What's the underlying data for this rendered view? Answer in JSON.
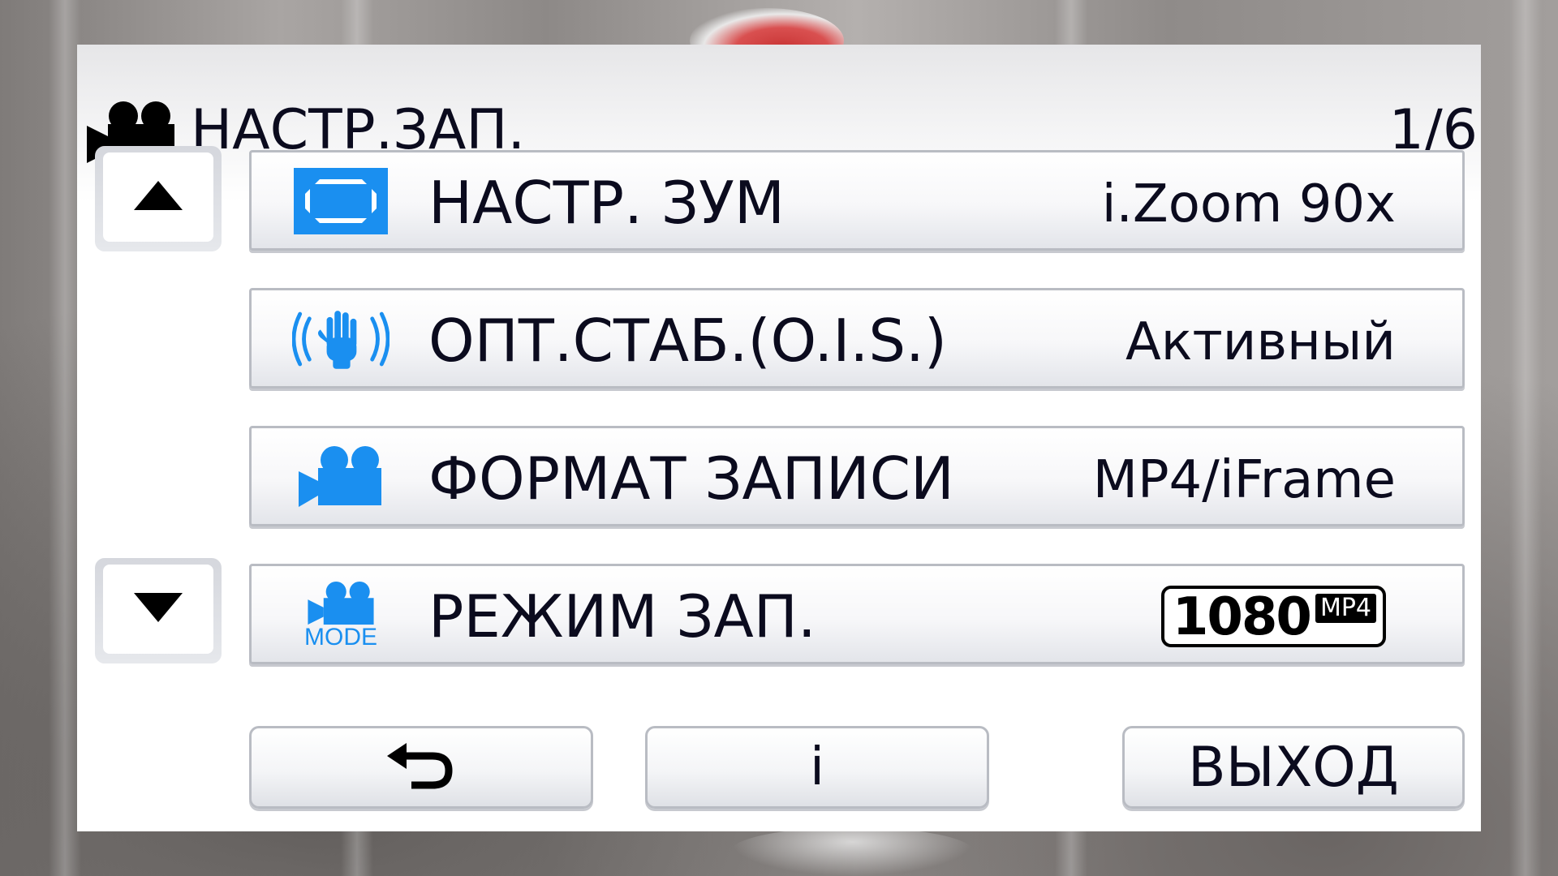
{
  "header": {
    "icon": "video-camera-icon",
    "title": "НАСТР.ЗАП.",
    "page_indicator": "1/6"
  },
  "navigation": {
    "up_icon": "triangle-up-icon",
    "down_icon": "triangle-down-icon"
  },
  "menu": {
    "items": [
      {
        "icon": "zoom-frame-icon",
        "label": "НАСТР. ЗУМ",
        "value": "i.Zoom 90x"
      },
      {
        "icon": "stabilizer-hand-icon",
        "label": "ОПТ.СТАБ.(O.I.S.)",
        "value": "Активный"
      },
      {
        "icon": "video-camera-icon",
        "label": "ФОРМАТ ЗАПИСИ",
        "value": "MP4/iFrame"
      },
      {
        "icon": "video-camera-mode-icon",
        "icon_text": "MODE",
        "label": "РЕЖИМ ЗАП.",
        "value_resolution": "1080",
        "value_format": "MP4"
      }
    ]
  },
  "footer": {
    "back_icon": "return-arrow-icon",
    "info_label": "i",
    "exit_label": "ВЫХОД"
  },
  "colors": {
    "accent_blue": "#1a8ff0",
    "text": "#0b0b1e",
    "row_border": "#b9bcc3"
  }
}
